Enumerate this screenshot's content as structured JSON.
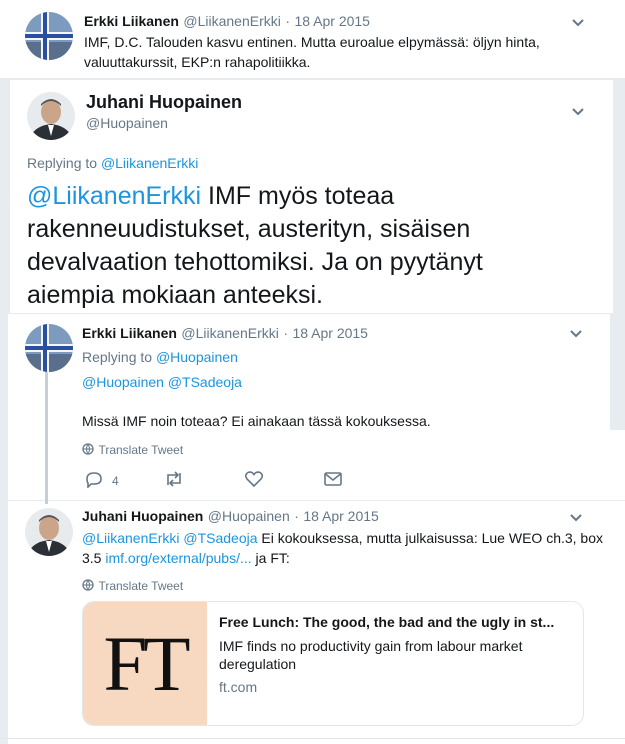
{
  "tweet1": {
    "name": "Erkki Liikanen",
    "handle": "@LiikanenErkki",
    "dot": "·",
    "date": "18 Apr 2015",
    "text_line1": "IMF, D.C. Talouden kasvu entinen. Mutta euroalue elpymässä: öljyn hinta,",
    "text_line2": "valuuttakurssit, EKP:n rahapolitiikka."
  },
  "focus": {
    "name": "Juhani Huopainen",
    "handle": "@Huopainen",
    "replying_prefix": "Replying to",
    "replying_to": "@LiikanenErkki",
    "mention": "@LiikanenErkki",
    "text_line1_rest": "IMF myös toteaa",
    "text_line2": "rakenneuudistukset, austerityn, sisäisen",
    "text_line3": "devalvaation tehottomiksi. Ja on pyytänyt",
    "text_line4": "aiempia mokiaan anteeksi."
  },
  "reply1": {
    "name": "Erkki Liikanen",
    "handle": "@LiikanenErkki",
    "dot": "·",
    "date": "18 Apr 2015",
    "replying_prefix": "Replying to",
    "replying_to": "@Huopainen",
    "mentions": "@Huopainen @TSadeoja",
    "text": "Missä IMF noin toteaa? Ei ainakaan tässä kokouksessa.",
    "translate": "Translate Tweet",
    "reply_count": "4"
  },
  "reply2": {
    "name": "Juhani Huopainen",
    "handle": "@Huopainen",
    "dot": "·",
    "date": "18 Apr 2015",
    "mentions": "@LiikanenErkki @TSadeoja",
    "text_rest": "Ei kokouksessa, mutta julkaisussa: Lue WEO ch.3, box",
    "text_line2_pre": "3.5",
    "url": "imf.org/external/pubs/...",
    "text_line2_post": "ja FT:",
    "translate": "Translate Tweet"
  },
  "link_card": {
    "logo_text": "FT",
    "title": "Free Lunch: The good, the bad and the ugly in st...",
    "desc_line1": "IMF finds no productivity gain from labour market",
    "desc_line2": "deregulation",
    "domain": "ft.com"
  },
  "colors": {
    "link": "#1b95e0",
    "muted": "#657786",
    "ft_bg": "#f6d9c0",
    "background": "#e6ecf0"
  }
}
